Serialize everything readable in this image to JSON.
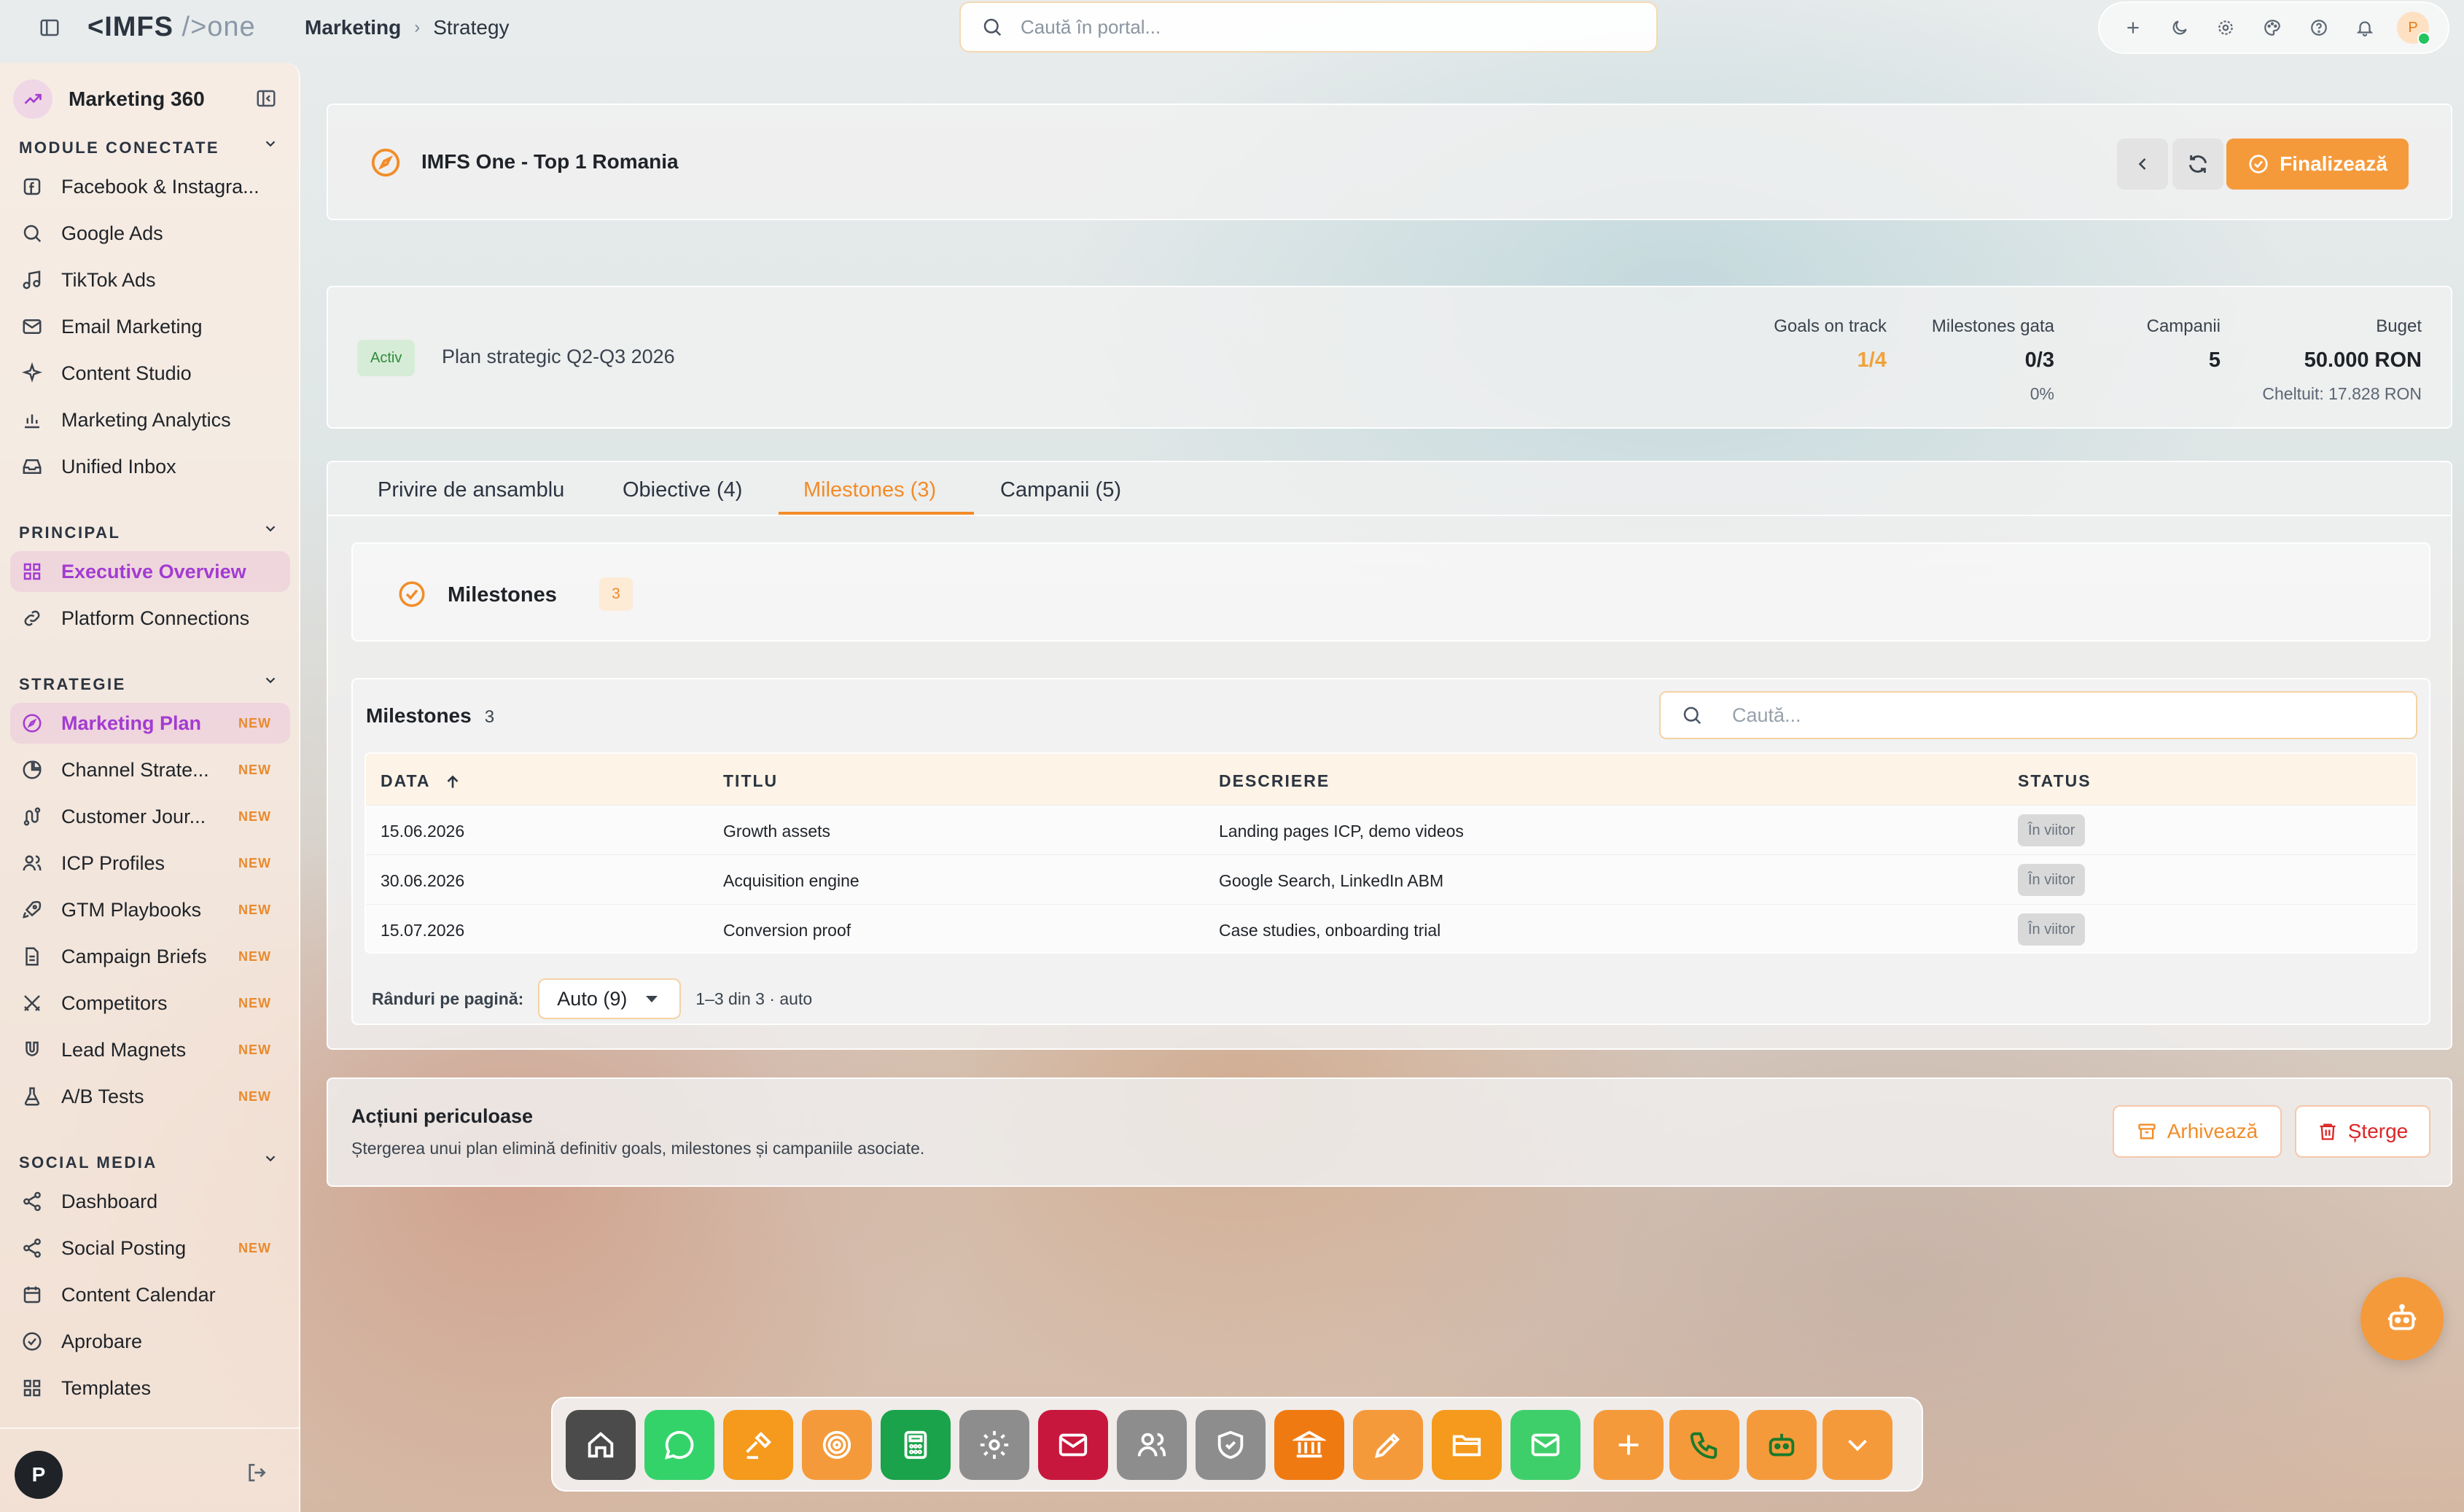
{
  "topbar": {
    "logo_main": "<IMFS",
    "logo_dim": "/>one",
    "breadcrumb": [
      "Marketing",
      "Strategy"
    ],
    "search_placeholder": "Caută în portal...",
    "avatar_letter": "P",
    "icons": [
      "plus-icon",
      "moon-icon",
      "gear-icon",
      "palette-icon",
      "help-icon",
      "bell-icon"
    ]
  },
  "sidebar": {
    "title": "Marketing 360",
    "sections": [
      {
        "label": "MODULE CONECTATE",
        "items": [
          {
            "label": "Facebook & Instagra...",
            "icon": "facebook-icon"
          },
          {
            "label": "Google Ads",
            "icon": "search-icon"
          },
          {
            "label": "TikTok Ads",
            "icon": "music-icon"
          },
          {
            "label": "Email Marketing",
            "icon": "mail-icon"
          },
          {
            "label": "Content Studio",
            "icon": "sparkle-icon"
          },
          {
            "label": "Marketing Analytics",
            "icon": "chart-icon"
          },
          {
            "label": "Unified Inbox",
            "icon": "inbox-icon"
          }
        ]
      },
      {
        "label": "PRINCIPAL",
        "items": [
          {
            "label": "Executive Overview",
            "icon": "grid-icon",
            "active": true
          },
          {
            "label": "Platform Connections",
            "icon": "link-icon"
          }
        ]
      },
      {
        "label": "STRATEGIE",
        "items": [
          {
            "label": "Marketing Plan",
            "icon": "compass-icon",
            "badge": "NEW",
            "active": true
          },
          {
            "label": "Channel Strate...",
            "icon": "pie-icon",
            "badge": "NEW"
          },
          {
            "label": "Customer Jour...",
            "icon": "route-icon",
            "badge": "NEW"
          },
          {
            "label": "ICP Profiles",
            "icon": "users-icon",
            "badge": "NEW"
          },
          {
            "label": "GTM Playbooks",
            "icon": "rocket-icon",
            "badge": "NEW"
          },
          {
            "label": "Campaign Briefs",
            "icon": "document-icon",
            "badge": "NEW"
          },
          {
            "label": "Competitors",
            "icon": "swords-icon",
            "badge": "NEW"
          },
          {
            "label": "Lead Magnets",
            "icon": "magnet-icon",
            "badge": "NEW"
          },
          {
            "label": "A/B Tests",
            "icon": "flask-icon",
            "badge": "NEW"
          }
        ]
      },
      {
        "label": "SOCIAL MEDIA",
        "items": [
          {
            "label": "Dashboard",
            "icon": "share-icon"
          },
          {
            "label": "Social Posting",
            "icon": "share-icon",
            "badge": "NEW"
          },
          {
            "label": "Content Calendar",
            "icon": "calendar-icon"
          },
          {
            "label": "Aprobare",
            "icon": "check-circle-icon"
          },
          {
            "label": "Templates",
            "icon": "grid-icon"
          }
        ]
      }
    ],
    "user_letter": "P"
  },
  "plan": {
    "title": "IMFS One - Top 1 Romania",
    "finalize_label": "Finalizează",
    "status_badge": "Activ",
    "subtitle": "Plan strategic Q2-Q3 2026",
    "stats": {
      "goals_label": "Goals on track",
      "goals_value": "1/4",
      "milestones_label": "Milestones gata",
      "milestones_value": "0/3",
      "milestones_pct": "0%",
      "campaigns_label": "Campanii",
      "campaigns_value": "5",
      "budget_label": "Buget",
      "budget_value": "50.000 RON",
      "budget_spent": "Cheltuit: 17.828 RON"
    }
  },
  "tabs": [
    "Privire de ansamblu",
    "Obiective (4)",
    "Milestones (3)",
    "Campanii (5)"
  ],
  "active_tab": "Milestones (3)",
  "milestones": {
    "header_title": "Milestones",
    "header_count": "3",
    "table_title": "Milestones",
    "table_count": "3",
    "search_placeholder": "Caută...",
    "columns": [
      "DATA",
      "TITLU",
      "DESCRIERE",
      "STATUS"
    ],
    "rows": [
      {
        "date": "15.06.2026",
        "title": "Growth assets",
        "desc": "Landing pages ICP, demo videos",
        "status": "În viitor"
      },
      {
        "date": "30.06.2026",
        "title": "Acquisition engine",
        "desc": "Google Search, LinkedIn ABM",
        "status": "În viitor"
      },
      {
        "date": "15.07.2026",
        "title": "Conversion proof",
        "desc": "Case studies, onboarding trial",
        "status": "În viitor"
      }
    ],
    "rows_per_page_label": "Rânduri pe pagină:",
    "rows_per_page_value": "Auto (9)",
    "page_info": "1–3 din 3 · auto"
  },
  "danger": {
    "title": "Acțiuni periculoase",
    "subtitle": "Ștergerea unui plan elimină definitiv goals, milestones și campaniile asociate.",
    "archive_label": "Arhivează",
    "delete_label": "Șterge"
  },
  "dock": {
    "apps": [
      {
        "name": "home-icon",
        "color": "#4b4b4b"
      },
      {
        "name": "chat-icon",
        "color": "#34d36a"
      },
      {
        "name": "gavel-icon",
        "color": "#f59a1c"
      },
      {
        "name": "target-icon",
        "color": "#f59a3b"
      },
      {
        "name": "calculator-icon",
        "color": "#1aa34a"
      },
      {
        "name": "gear-icon",
        "color": "#8d8d8d"
      },
      {
        "name": "mail-icon",
        "color": "#c8173c"
      },
      {
        "name": "users-icon",
        "color": "#8d8d8d"
      },
      {
        "name": "shield-icon",
        "color": "#8d8d8d"
      },
      {
        "name": "bank-icon",
        "color": "#f07a12"
      },
      {
        "name": "pen-icon",
        "color": "#f59a3b"
      },
      {
        "name": "folder-icon",
        "color": "#f59a1c"
      },
      {
        "name": "mail-icon",
        "color": "#3fcf6a"
      },
      {
        "name": "plus-icon",
        "color": "#f59a3b"
      },
      {
        "name": "phone-icon",
        "color": "#f59a3b"
      },
      {
        "name": "robot-icon",
        "color": "#f59a3b"
      },
      {
        "name": "chevron-down-icon",
        "color": "#f59a3b"
      }
    ]
  }
}
